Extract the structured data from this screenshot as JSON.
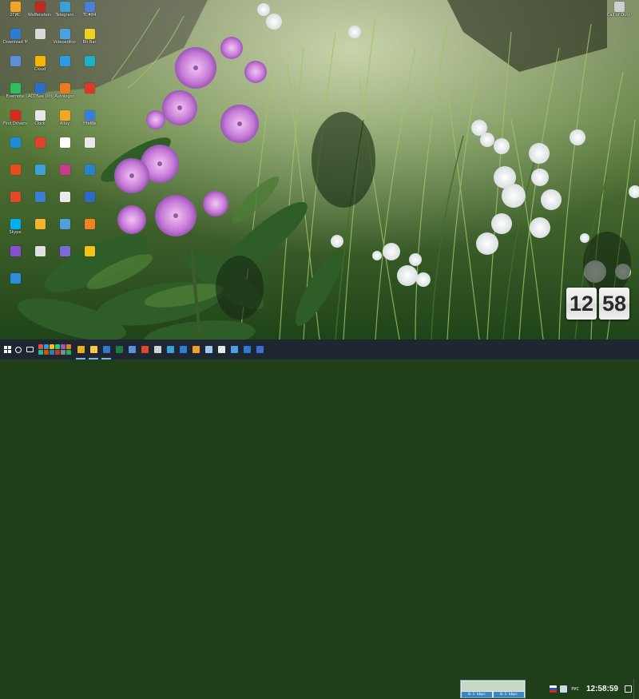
{
  "desktop": {
    "icons": [
      {
        "label": "2ГИС",
        "color": "#f2a623"
      },
      {
        "label": "Wolfenstein The New",
        "color": "#c22a21"
      },
      {
        "label": "Telegram",
        "color": "#3aa0d8"
      },
      {
        "label": "TC#84",
        "color": "#4b7fd6"
      },
      {
        "label": "Download Master",
        "color": "#2d7bd1"
      },
      {
        "label": "",
        "color": "#d9d9d9"
      },
      {
        "label": "Videoeditor",
        "color": "#4aa3e0"
      },
      {
        "label": "Bit Bar",
        "color": "#f0d020"
      },
      {
        "label": "",
        "color": "#5e8fd8"
      },
      {
        "label": "Cloud",
        "color": "#f6b500"
      },
      {
        "label": "",
        "color": "#2c9be8"
      },
      {
        "label": "",
        "color": "#1cb0c8"
      },
      {
        "label": "Evernote",
        "color": "#2dbe60"
      },
      {
        "label": "ACDSee Ultimate",
        "color": "#2a6ec9"
      },
      {
        "label": "Autologon",
        "color": "#e97b1e"
      },
      {
        "label": "",
        "color": "#d83b2a"
      },
      {
        "label": "Find Drivers",
        "color": "#d62a1e"
      },
      {
        "label": "Clock",
        "color": "#e8e8e8"
      },
      {
        "label": "Alloy",
        "color": "#f2a623"
      },
      {
        "label": "YiteWe",
        "color": "#3a7fd5"
      },
      {
        "label": "",
        "color": "#1a8fd8"
      },
      {
        "label": "",
        "color": "#e3402b"
      },
      {
        "label": "",
        "color": "#ffffff"
      },
      {
        "label": "",
        "color": "#e9e9e9"
      },
      {
        "label": "",
        "color": "#e74c1c"
      },
      {
        "label": "",
        "color": "#3fa0d5"
      },
      {
        "label": "",
        "color": "#c63b8a"
      },
      {
        "label": "",
        "color": "#2a83c9"
      },
      {
        "label": "",
        "color": "#e6472a"
      },
      {
        "label": "",
        "color": "#3d7fcf"
      },
      {
        "label": "",
        "color": "#eaeaea"
      },
      {
        "label": "",
        "color": "#2f69c7"
      },
      {
        "label": "Skype",
        "color": "#00aff0"
      },
      {
        "label": "",
        "color": "#f4b32a"
      },
      {
        "label": "",
        "color": "#4fa1dc"
      },
      {
        "label": "",
        "color": "#f58220"
      },
      {
        "label": "",
        "color": "#8a4fd1"
      },
      {
        "label": "",
        "color": "#e0e0e0"
      },
      {
        "label": "",
        "color": "#7a6ad6"
      },
      {
        "label": "",
        "color": "#f4c21a"
      },
      {
        "label": "",
        "color": "#2b8ddb"
      }
    ],
    "top_right_icon": {
      "label": "Call of Duty Ghosts",
      "color": "#cfcfcf"
    }
  },
  "clock_widget": {
    "hours": "12",
    "minutes": "58"
  },
  "taskbar": {
    "accent": "#1d2631",
    "apps": [
      {
        "name": "chrome-icon",
        "color": "#e8b11f"
      },
      {
        "name": "explorer-icon",
        "color": "#f2c94c"
      },
      {
        "name": "settings-icon",
        "color": "#3478c9"
      },
      {
        "name": "app-icon",
        "color": "#1f7a3f"
      },
      {
        "name": "app-icon",
        "color": "#5e8fd8"
      },
      {
        "name": "app-icon",
        "color": "#e04a2a"
      },
      {
        "name": "app-icon",
        "color": "#d2d2d2"
      },
      {
        "name": "app-icon",
        "color": "#3aa0d8"
      },
      {
        "name": "app-icon",
        "color": "#2f7fd0"
      },
      {
        "name": "app-icon",
        "color": "#f0a030"
      },
      {
        "name": "app-icon",
        "color": "#a0c8ef"
      },
      {
        "name": "app-icon",
        "color": "#e8e8e8"
      },
      {
        "name": "app-icon",
        "color": "#4aa3e0"
      },
      {
        "name": "app-icon",
        "color": "#2d7bd1"
      },
      {
        "name": "app-icon",
        "color": "#3c6fd1"
      }
    ],
    "net_meter": {
      "down": "0.1 kbps",
      "up": "0.1 kbps"
    },
    "language": "РУС",
    "time": "12:58:59"
  }
}
